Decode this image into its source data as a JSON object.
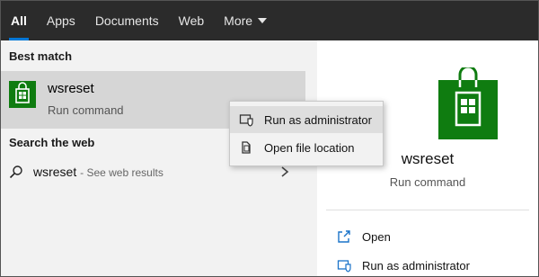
{
  "tabs": [
    {
      "label": "All"
    },
    {
      "label": "Apps"
    },
    {
      "label": "Documents"
    },
    {
      "label": "Web"
    },
    {
      "label": "More"
    }
  ],
  "left_panel": {
    "best_match_title": "Best match",
    "best_match": {
      "name": "wsreset",
      "type": "Run command",
      "icon": "store-icon"
    },
    "search_web_title": "Search the web",
    "web_result": {
      "query": "wsreset",
      "hint": "- See web results",
      "icon": "search-icon"
    }
  },
  "context_menu": {
    "items": [
      {
        "label": "Run as administrator",
        "icon": "shield-icon"
      },
      {
        "label": "Open file location",
        "icon": "folder-icon"
      }
    ]
  },
  "right_panel": {
    "app_name": "wsreset",
    "app_type": "Run command",
    "actions": [
      {
        "label": "Open",
        "icon": "open-icon"
      },
      {
        "label": "Run as administrator",
        "icon": "shield-icon"
      }
    ]
  },
  "colors": {
    "accent": "#0078d7",
    "store_green": "#0f7c10",
    "tabbar": "#2b2b2b"
  }
}
